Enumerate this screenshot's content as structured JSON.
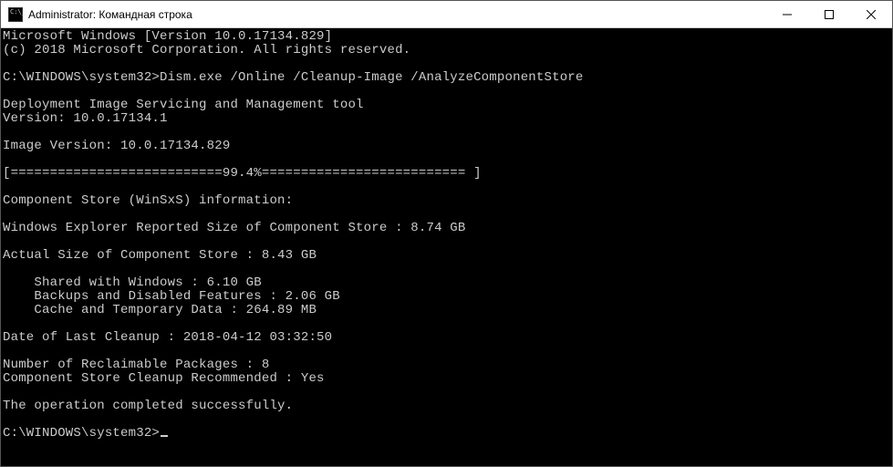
{
  "window": {
    "title": "Administrator: Командная строка"
  },
  "term": {
    "line_os": "Microsoft Windows [Version 10.0.17134.829]",
    "line_copy": "(c) 2018 Microsoft Corporation. All rights reserved.",
    "prompt1": "C:\\WINDOWS\\system32>",
    "cmd1": "Dism.exe /Online /Cleanup-Image /AnalyzeComponentStore",
    "tool": "Deployment Image Servicing and Management tool",
    "tool_ver": "Version: 10.0.17134.1",
    "img_ver": "Image Version: 10.0.17134.829",
    "progress": "[===========================99.4%========================== ]",
    "cs_info": "Component Store (WinSxS) information:",
    "explorer_size": "Windows Explorer Reported Size of Component Store : 8.74 GB",
    "actual_size": "Actual Size of Component Store : 8.43 GB",
    "shared": "    Shared with Windows : 6.10 GB",
    "backups": "    Backups and Disabled Features : 2.06 GB",
    "cache": "    Cache and Temporary Data : 264.89 MB",
    "last_cleanup": "Date of Last Cleanup : 2018-04-12 03:32:50",
    "reclaimable": "Number of Reclaimable Packages : 8",
    "recommended": "Component Store Cleanup Recommended : Yes",
    "completed": "The operation completed successfully.",
    "prompt2": "C:\\WINDOWS\\system32>"
  }
}
